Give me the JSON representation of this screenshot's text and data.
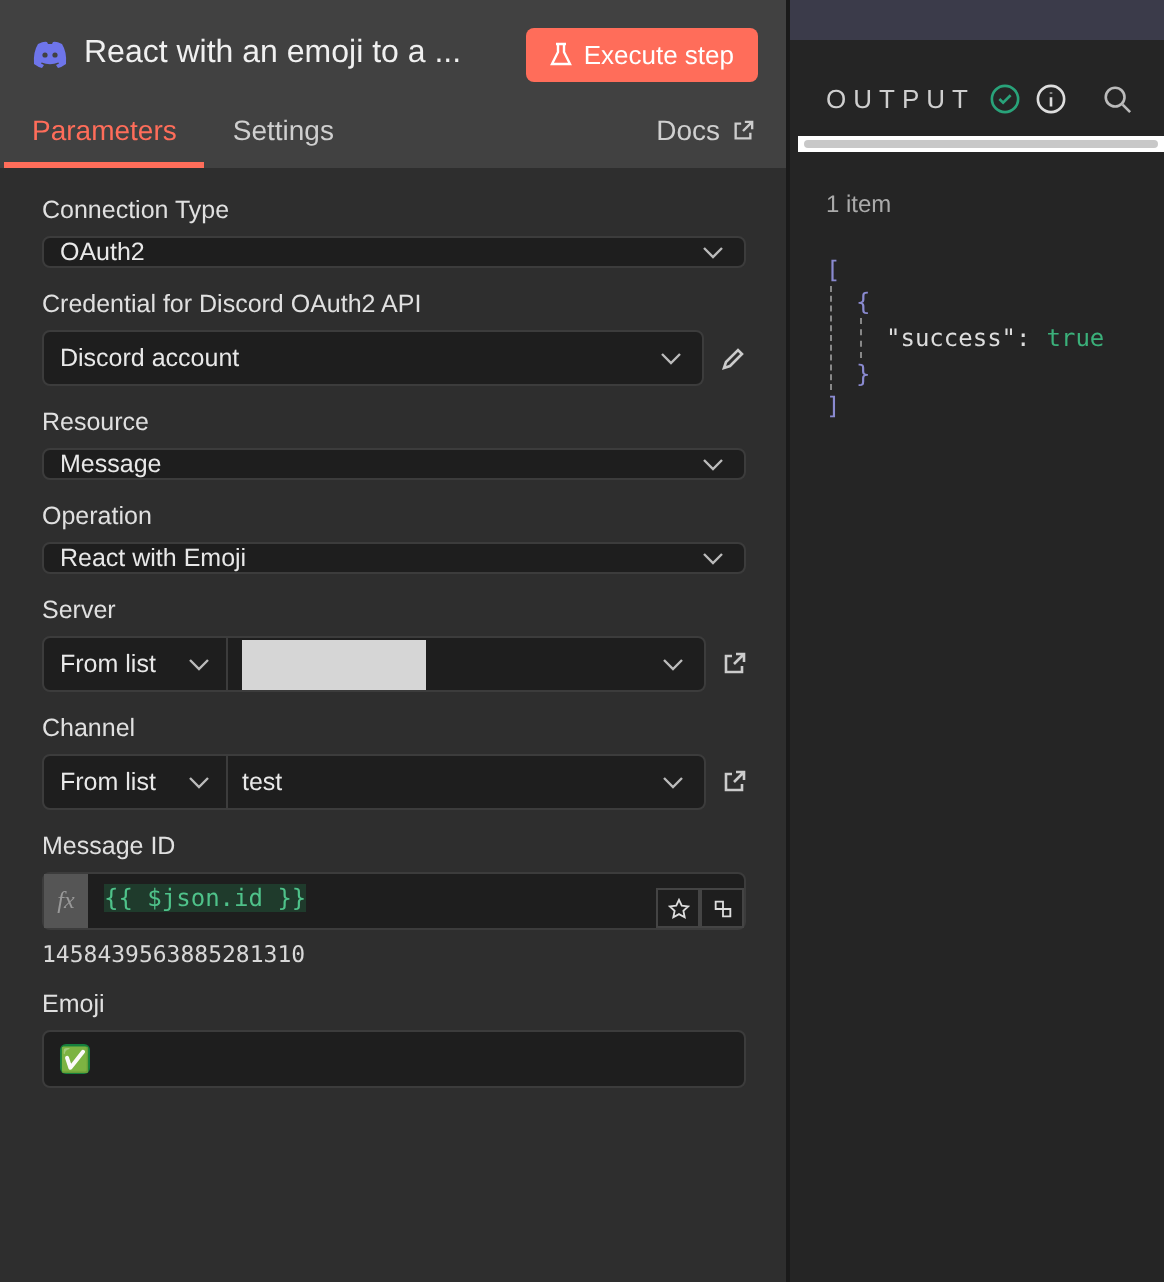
{
  "node": {
    "title": "React with an emoji to a ...",
    "execute_button": "Execute step"
  },
  "tabs": [
    {
      "label": "Parameters",
      "selected": true
    },
    {
      "label": "Settings",
      "selected": false
    }
  ],
  "docs_link": "Docs",
  "fields": [
    {
      "kind": "select",
      "label": "Connection Type",
      "value": "OAuth2"
    },
    {
      "kind": "credential",
      "label": "Credential for Discord OAuth2 API",
      "value": "Discord account"
    },
    {
      "kind": "select",
      "label": "Resource",
      "value": "Message"
    },
    {
      "kind": "select",
      "label": "Operation",
      "value": "React with Emoji"
    },
    {
      "kind": "locator",
      "label": "Server",
      "mode": "From list",
      "redacted": true
    },
    {
      "kind": "locator",
      "label": "Channel",
      "mode": "From list",
      "value": "test",
      "redacted": false
    },
    {
      "kind": "expression",
      "label": "Message ID",
      "fx": "fx",
      "value": "{{ $json.id }}",
      "result": "1458439563885281310"
    },
    {
      "kind": "text",
      "label": "Emoji",
      "value": "✅"
    }
  ],
  "output": {
    "title": "OUTPUT",
    "success": true,
    "item_count": "1 item",
    "json": {
      "array_open": "[",
      "object_open": "{",
      "key": "\"success\":",
      "value": "true",
      "object_close": "}",
      "array_close": "]"
    }
  }
}
